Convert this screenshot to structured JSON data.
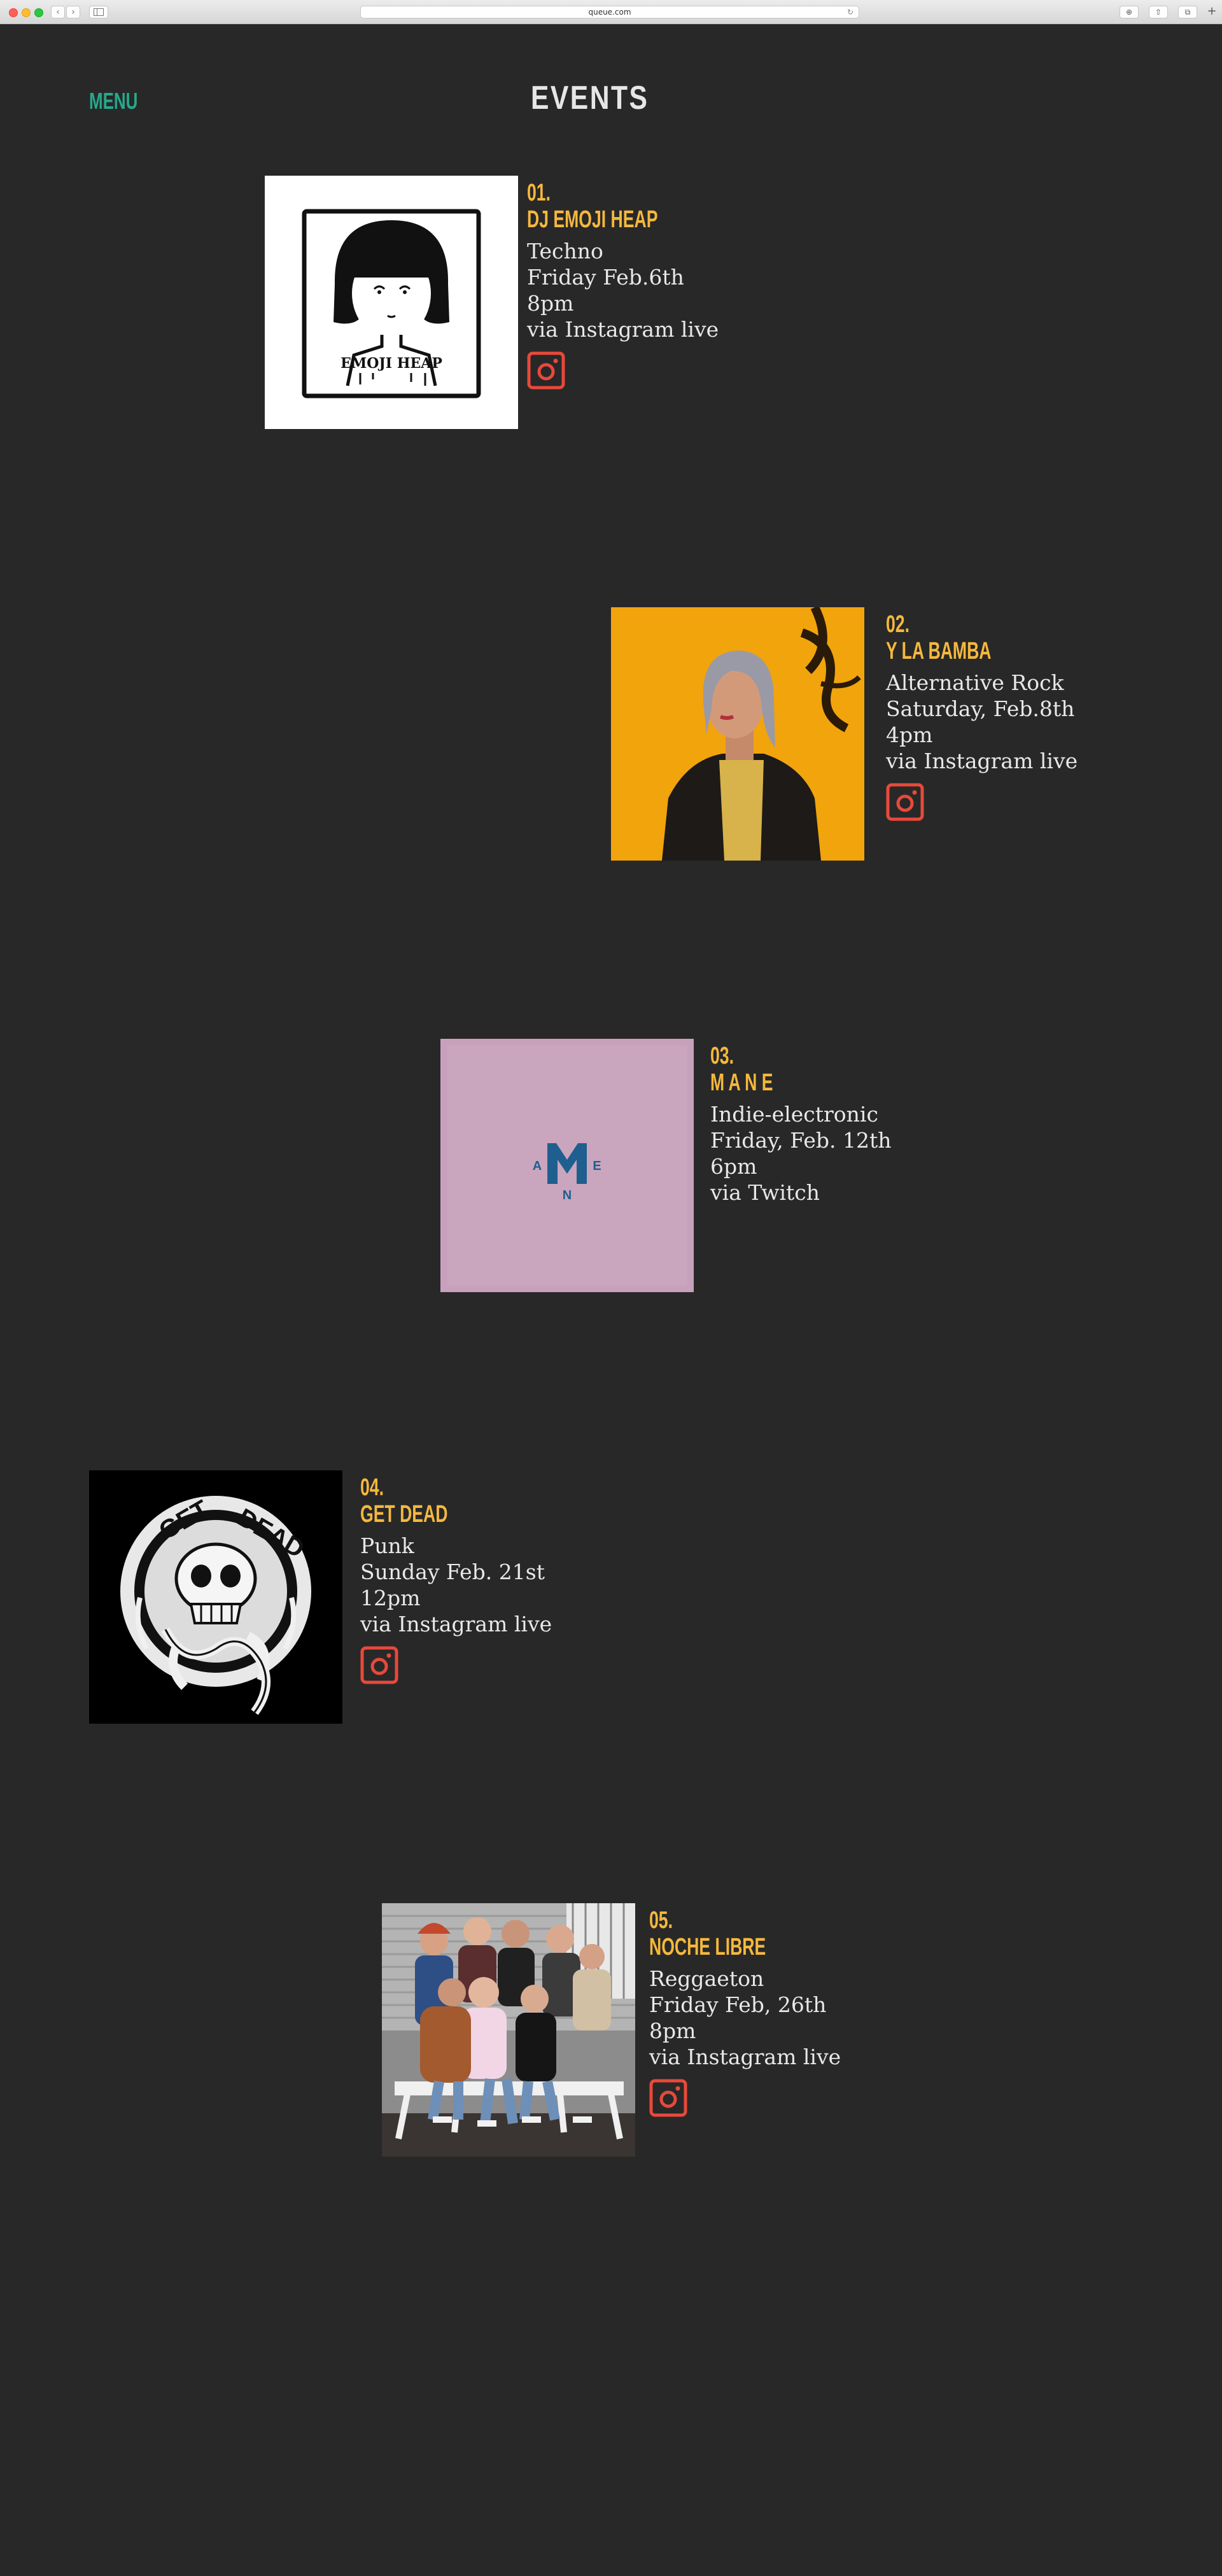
{
  "browser": {
    "url": "queue.com",
    "back_icon": "‹",
    "forward_icon": "›"
  },
  "header": {
    "menu_label": "MENU",
    "title": "EVENTS"
  },
  "colors": {
    "background": "#282828",
    "menu": "#25a98c",
    "event_name": "#f5b83d",
    "instagram_icon": "#e8493a",
    "detail_text": "#e8e8e8"
  },
  "events": [
    {
      "number": "01.",
      "name": "DJ EMOJI HEAP",
      "genre": "Techno",
      "date": "Friday Feb.6th",
      "time": "8pm",
      "platform": "via Instagram live",
      "has_instagram_link": true,
      "image_icon": "emoji-heap-illustration",
      "image_text": "EMOJI HEAP"
    },
    {
      "number": "02.",
      "name": "Y LA BAMBA",
      "genre": "Alternative Rock",
      "date": "Saturday, Feb.8th",
      "time": "4pm",
      "platform": "via Instagram live",
      "has_instagram_link": true,
      "image_icon": "portrait-photo"
    },
    {
      "number": "03.",
      "name": "M A N E",
      "genre": "Indie-electronic",
      "date": "Friday, Feb. 12th",
      "time": "6pm",
      "platform": "via Twitch",
      "has_instagram_link": false,
      "image_icon": "mane-logo",
      "logo_letters": [
        "A",
        "M",
        "E",
        "N"
      ]
    },
    {
      "number": "04.",
      "name": "GET DEAD",
      "genre": "Punk",
      "date": "Sunday Feb. 21st",
      "time": "12pm",
      "platform": "via Instagram live",
      "has_instagram_link": true,
      "image_icon": "get-dead-skull-logo",
      "logo_words": [
        "GET",
        "DEAD"
      ]
    },
    {
      "number": "05.",
      "name": "NOCHE LIBRE",
      "genre": "Reggaeton",
      "date": "Friday Feb, 26th",
      "time": "8pm",
      "platform": "via Instagram live",
      "has_instagram_link": true,
      "image_icon": "band-group-photo"
    }
  ]
}
